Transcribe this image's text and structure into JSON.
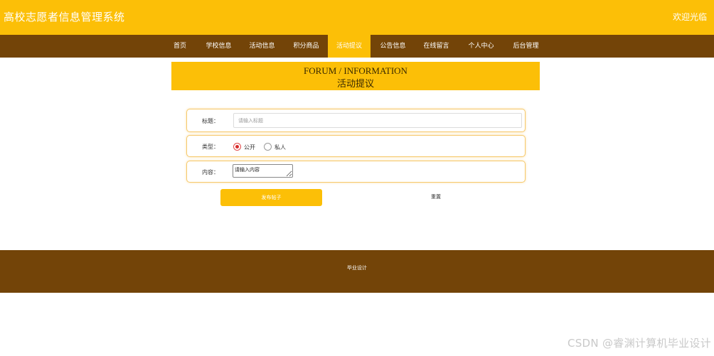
{
  "header": {
    "site_title": "高校志愿者信息管理系统",
    "welcome_text": "欢迎光临"
  },
  "nav": {
    "items": [
      {
        "label": "首页"
      },
      {
        "label": "学校信息"
      },
      {
        "label": "活动信息"
      },
      {
        "label": "积分商品"
      },
      {
        "label": "活动提议",
        "active": true
      },
      {
        "label": "公告信息"
      },
      {
        "label": "在线留言"
      },
      {
        "label": "个人中心"
      },
      {
        "label": "后台管理"
      }
    ]
  },
  "banner": {
    "title_en": "FORUM / INFORMATION",
    "title_cn": "活动提议"
  },
  "form": {
    "title_label": "标题：",
    "title_placeholder": "请输入标题",
    "title_value": "",
    "type_label": "类型：",
    "type_options": [
      {
        "label": "公开",
        "selected": true
      },
      {
        "label": "私人",
        "selected": false
      }
    ],
    "content_label": "内容：",
    "content_placeholder": "请输入内容",
    "submit_label": "发布帖子",
    "reset_label": "重置"
  },
  "footer": {
    "text": "毕业设计"
  },
  "watermark": {
    "text": "CSDN @睿渊计算机毕业设计"
  },
  "colors": {
    "accent_yellow": "#fcbf07",
    "nav_brown": "#734408",
    "radio_red": "#d62b2b"
  }
}
